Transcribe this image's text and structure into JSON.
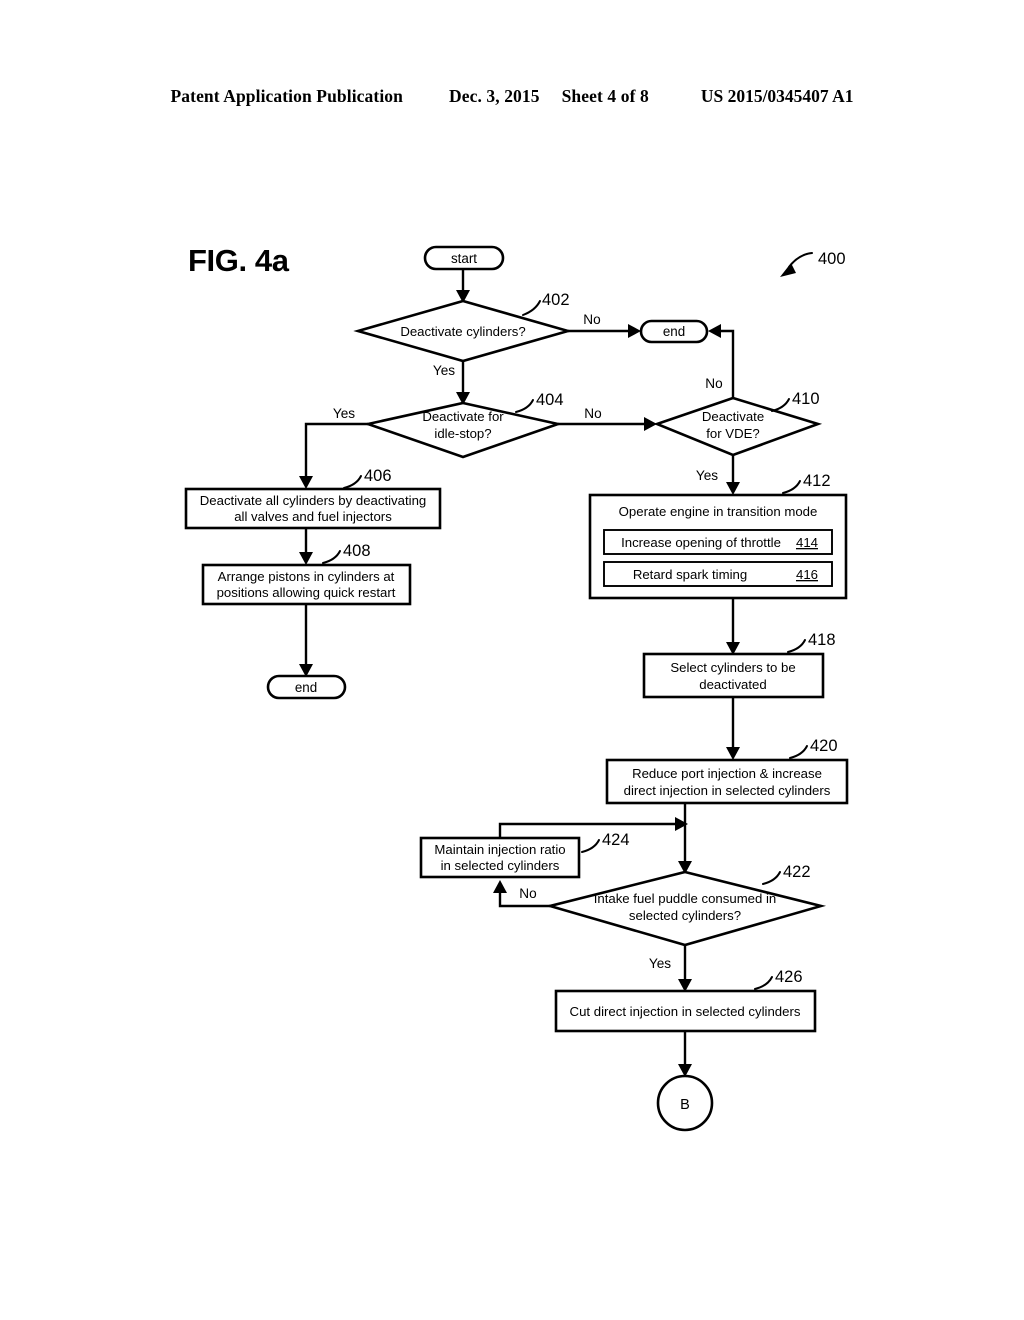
{
  "header": {
    "publication": "Patent Application Publication",
    "date": "Dec. 3, 2015",
    "sheet": "Sheet 4 of 8",
    "patent_number": "US 2015/0345407 A1"
  },
  "figure": {
    "label": "FIG. 4a",
    "diagram_ref": "400"
  },
  "nodes": {
    "start": {
      "ref": "",
      "text": "start"
    },
    "end_top": {
      "ref": "",
      "text": "end"
    },
    "end_left": {
      "ref": "",
      "text": "end"
    },
    "d402": {
      "ref": "402",
      "text": "Deactivate cylinders?"
    },
    "d404": {
      "ref": "404",
      "line1": "Deactivate for",
      "line2": "idle-stop?"
    },
    "d410": {
      "ref": "410",
      "line1": "Deactivate",
      "line2": "for VDE?"
    },
    "p406": {
      "ref": "406",
      "line1": "Deactivate all cylinders by deactivating",
      "line2": "all valves and fuel injectors"
    },
    "p408": {
      "ref": "408",
      "line1": "Arrange pistons in cylinders at",
      "line2": "positions allowing quick restart"
    },
    "p412": {
      "ref": "412",
      "title": "Operate engine in transition mode"
    },
    "p414": {
      "ref": "414",
      "text": "Increase opening of throttle"
    },
    "p416": {
      "ref": "416",
      "text": "Retard spark timing"
    },
    "p418": {
      "ref": "418",
      "line1": "Select cylinders to be",
      "line2": "deactivated"
    },
    "p420": {
      "ref": "420",
      "line1": "Reduce port injection & increase",
      "line2": "direct injection in selected cylinders"
    },
    "d422": {
      "ref": "422",
      "line1": "Intake fuel puddle consumed in",
      "line2": "selected cylinders?"
    },
    "p424": {
      "ref": "424",
      "line1": "Maintain injection ratio",
      "line2": "in selected cylinders"
    },
    "p426": {
      "ref": "426",
      "text": "Cut direct injection in selected cylinders"
    },
    "connector_b": {
      "ref": "",
      "text": "B"
    }
  },
  "edge_labels": {
    "e402_no": "No",
    "e402_yes": "Yes",
    "e404_yes": "Yes",
    "e404_no": "No",
    "e410_no": "No",
    "e410_yes": "Yes",
    "e422_no": "No",
    "e422_yes": "Yes"
  },
  "colors": {
    "ink": "#000000",
    "paper": "#ffffff"
  }
}
